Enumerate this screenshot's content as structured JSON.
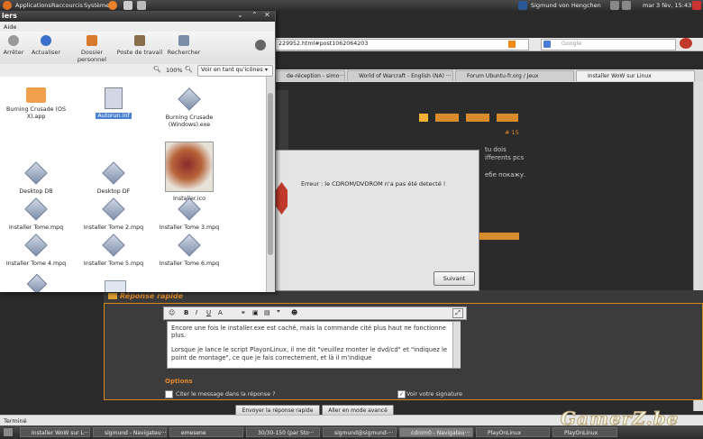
{
  "top_panel": {
    "menus": [
      "Applications",
      "Raccourcis",
      "Système"
    ],
    "user": "Sigmund von Hengchen",
    "clock": "mar  3 fév, 15:43",
    "colors": {
      "bg": "#333333",
      "accent": "#e07020"
    }
  },
  "firefox": {
    "url": "229952.html#post1062064203",
    "search_placeholder": "Google",
    "tabs": [
      "de-réception - simo···",
      "World of Warcraft - English (NA) ···",
      "Forum Ubuntu-fr.org / Jeux",
      "Installer WoW sur Linux"
    ],
    "forum": {
      "post_num": "# 15",
      "snippet_lines": [
        "tu dois",
        "ifferents pcs",
        "ебе покажу."
      ],
      "quick_reply_title": "Réponse rapide",
      "editor_text_line1": "Encore une fois le installer.exe est caché, mais la commande cité plus haut ne fonctionne plus.",
      "editor_text_line2": "Lorsque je lance le script PlayonLinux, il me dit \"veuillez monter le dvd/cd\" et \"indiquez le point de montage\", ce que je fais correctement, et là il m'indique",
      "options_label": "Options",
      "quote_checkbox": "Citer le message dans la réponse ?",
      "signature_checkbox": "Voir votre signature",
      "send_button": "Envoyer la réponse rapide",
      "advanced_button": "Aller en mode avancé"
    },
    "status": "Terminé"
  },
  "file_manager": {
    "title": "iers",
    "menu": "Aide",
    "toolbar": [
      "Arrêter",
      "Actualiser",
      "Dossier personnel",
      "Poste de travail",
      "Rechercher"
    ],
    "zoom": "100%",
    "view_mode": "Voir en tant qu'icônes",
    "items": [
      {
        "label": "Burning Crusade (OS X).app",
        "icon": "folder-icon"
      },
      {
        "label": "Autorun.inf",
        "icon": "text-file-icon",
        "selected": true
      },
      {
        "label": "Burning Crusade (Windows).exe",
        "icon": "wine-exe-icon"
      },
      {
        "label": "Desktop DB",
        "icon": "wine-exe-icon"
      },
      {
        "label": "Desktop DF",
        "icon": "wine-exe-icon"
      },
      {
        "label": "Installer.ico",
        "icon": "dragon-image-icon"
      },
      {
        "label": "Installer Tome.mpq",
        "icon": "wine-exe-icon"
      },
      {
        "label": "Installer Tome 2.mpq",
        "icon": "wine-exe-icon"
      },
      {
        "label": "Installer Tome 3.mpq",
        "icon": "wine-exe-icon"
      },
      {
        "label": "Installer Tome 4.mpq",
        "icon": "wine-exe-icon"
      },
      {
        "label": "Installer Tome 5.mpq",
        "icon": "wine-exe-icon"
      },
      {
        "label": "Installer Tome 6.mpq",
        "icon": "wine-exe-icon"
      }
    ]
  },
  "dialog": {
    "message": "Erreur : le CDROM/DVDROM n'a pas été detecté !",
    "button": "Suivant"
  },
  "taskbar": {
    "tasks": [
      "Installer WoW sur L···",
      "sigmund - Navigateu···",
      "emesene",
      "30/30-150 (par Sto···",
      "sigmund@sigmund-···",
      "cdrom0 - Navigateu···",
      "PlayOnLinux",
      "PlayOnLinux"
    ]
  },
  "watermark": "GamerZ.be"
}
